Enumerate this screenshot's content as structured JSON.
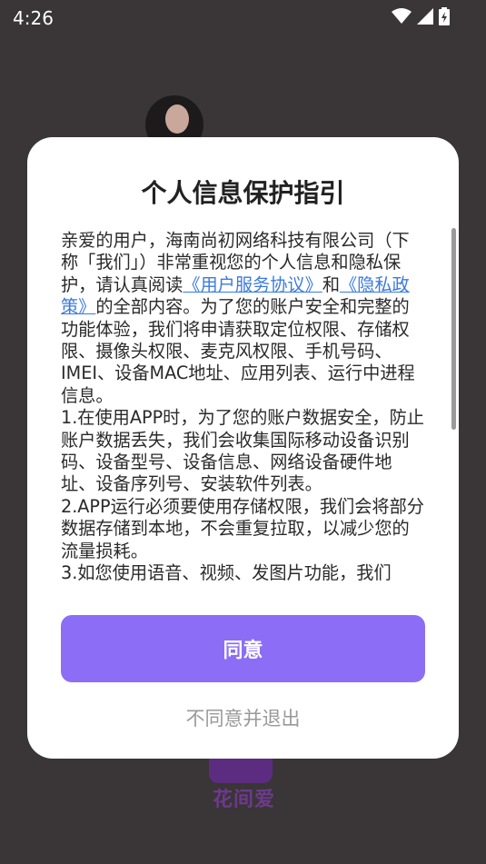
{
  "status_bar": {
    "time": "4:26",
    "icons": [
      "wifi-icon",
      "cell-signal-icon",
      "battery-charging-icon"
    ]
  },
  "background": {
    "logo_text": "花间爱"
  },
  "dialog": {
    "title": "个人信息保护指引",
    "intro_before_links": "亲爱的用户，海南尚初网络科技有限公司（下称「我们」）非常重视您的个人信息和隐私保护，请认真阅读",
    "user_agreement_link": "《用户服务协议》",
    "link_joiner": "和",
    "privacy_policy_link": "《隐私政策》",
    "intro_after_links": "的全部内容。为了您的账户安全和完整的功能体验，我们将申请获取定位权限、存储权限、摄像头权限、麦克风权限、手机号码、IMEI、设备MAC地址、应用列表、运行中进程信息。",
    "point_1": "1.在使用APP时，为了您的账户数据安全，防止账户数据丢失，我们会收集国际移动设备识别码、设备型号、设备信息、网络设备硬件地址、设备序列号、安装软件列表。",
    "point_2": "2.APP运行必须要使用存储权限，我们会将部分数据存储到本地，不会重复拉取，以减少您的流量损耗。",
    "point_3": "3.如您使用语音、视频、发图片功能，我们",
    "agree_label": "同意",
    "disagree_label": "不同意并退出",
    "accent_color": "#8b6ef5",
    "link_color": "#3b7ae0"
  }
}
